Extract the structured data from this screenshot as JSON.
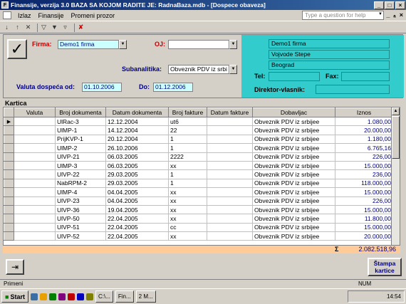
{
  "window": {
    "title": "Finansije, verzija 3.0      BAZA SA KOJOM RADITE JE: RadnaBaza.mdb - [Dospece obaveza]",
    "minimize": "_",
    "maximize": "□",
    "close": "×"
  },
  "menu": {
    "items": [
      "Izlaz",
      "Finansije",
      "Promeni prozor"
    ],
    "help_placeholder": "Type a question for help",
    "mdi_buttons": [
      "_",
      "ₐ",
      "×"
    ]
  },
  "toolbar": {
    "icons": [
      "sort-asc-icon",
      "sort-desc-icon",
      "filter-off-icon",
      "filter-icon",
      "filter-form-icon",
      "filter-apply-icon",
      "delete-filter-icon"
    ]
  },
  "form": {
    "firma_label": "Firma:",
    "firma_value": "Demo1 firma",
    "oj_label": "OJ:",
    "oj_value": "",
    "subanalitika_label": "Subanalitika:",
    "subanalitika_value": "Obveznik PDV iz srbi",
    "valuta_od_label": "Valuta dospeća od:",
    "valuta_od_value": "01.10.2006",
    "do_label": "Do:",
    "do_value": "01.12.2006"
  },
  "firm_panel": {
    "name": "Demo1 firma",
    "street": "Vojvode Stepe",
    "city": "Beograd",
    "tel_label": "Tel:",
    "tel_value": "",
    "fax_label": "Fax:",
    "fax_value": "",
    "director_label": "Direktor-vlasnik:",
    "director_value": ""
  },
  "kartica": {
    "label": "Kartica",
    "columns": [
      "Valuta",
      "Broj dokumenta",
      "Datum dokumenta",
      "Broj fakture",
      "Datum fakture",
      "Dobavljac",
      "Iznos"
    ],
    "rows": [
      {
        "valuta": "",
        "broj_dok": "UlRac-3",
        "datum_dok": "12.12.2004",
        "broj_fak": "ut6",
        "datum_fak": "",
        "dobavljac": "Obveznik PDV iz srbijee",
        "iznos": "1.080,00"
      },
      {
        "valuta": "",
        "broj_dok": "UlMP-1",
        "datum_dok": "14.12.2004",
        "broj_fak": "22",
        "datum_fak": "",
        "dobavljac": "Obveznik PDV iz srbijee",
        "iznos": "20.000,00"
      },
      {
        "valuta": "",
        "broj_dok": "PrijKVP-1",
        "datum_dok": "20.12.2004",
        "broj_fak": "1",
        "datum_fak": "",
        "dobavljac": "Obveznik PDV iz srbijee",
        "iznos": "1.180,00"
      },
      {
        "valuta": "",
        "broj_dok": "UlMP-2",
        "datum_dok": "26.10.2006",
        "broj_fak": "1",
        "datum_fak": "",
        "dobavljac": "Obveznik PDV iz srbijee",
        "iznos": "6.765,16"
      },
      {
        "valuta": "",
        "broj_dok": "UlVP-21",
        "datum_dok": "06.03.2005",
        "broj_fak": "2222",
        "datum_fak": "",
        "dobavljac": "Obveznik PDV iz srbijee",
        "iznos": "226,00"
      },
      {
        "valuta": "",
        "broj_dok": "UlMP-3",
        "datum_dok": "06.03.2005",
        "broj_fak": "xx",
        "datum_fak": "",
        "dobavljac": "Obveznik PDV iz srbijee",
        "iznos": "15.000,00"
      },
      {
        "valuta": "",
        "broj_dok": "UlVP-22",
        "datum_dok": "29.03.2005",
        "broj_fak": "1",
        "datum_fak": "",
        "dobavljac": "Obveznik PDV iz srbijee",
        "iznos": "236,00"
      },
      {
        "valuta": "",
        "broj_dok": "NabRPM-2",
        "datum_dok": "29.03.2005",
        "broj_fak": "1",
        "datum_fak": "",
        "dobavljac": "Obveznik PDV iz srbijee",
        "iznos": "118.000,00"
      },
      {
        "valuta": "",
        "broj_dok": "UlMP-4",
        "datum_dok": "04.04.2005",
        "broj_fak": "xx",
        "datum_fak": "",
        "dobavljac": "Obveznik PDV iz srbijee",
        "iznos": "15.000,00"
      },
      {
        "valuta": "",
        "broj_dok": "UlVP-23",
        "datum_dok": "04.04.2005",
        "broj_fak": "xx",
        "datum_fak": "",
        "dobavljac": "Obveznik PDV iz srbijee",
        "iznos": "226,00"
      },
      {
        "valuta": "",
        "broj_dok": "UlVP-36",
        "datum_dok": "19.04.2005",
        "broj_fak": "xx",
        "datum_fak": "",
        "dobavljac": "Obveznik PDV iz srbijee",
        "iznos": "15.000,00"
      },
      {
        "valuta": "",
        "broj_dok": "UlVP-50",
        "datum_dok": "22.04.2005",
        "broj_fak": "xx",
        "datum_fak": "",
        "dobavljac": "Obveznik PDV iz srbijee",
        "iznos": "11.800,00"
      },
      {
        "valuta": "",
        "broj_dok": "UlVP-51",
        "datum_dok": "22.04.2005",
        "broj_fak": "cc",
        "datum_fak": "",
        "dobavljac": "Obveznik PDV iz srbijee",
        "iznos": "15.000,00"
      },
      {
        "valuta": "",
        "broj_dok": "UlVP-52",
        "datum_dok": "22.04.2005",
        "broj_fak": "xx",
        "datum_fak": "",
        "dobavljac": "Obveznik PDV iz srbijee",
        "iznos": "20.000,00"
      }
    ],
    "sigma": "Σ",
    "total": "2.082.518,96"
  },
  "buttons": {
    "stampa_line1": "Štampa",
    "stampa_line2": "kartice"
  },
  "status": {
    "text": "Primeni",
    "num": "NUM"
  },
  "taskbar": {
    "start": "Start",
    "tasks": [
      "C:\\...",
      "Fin...",
      "2 M..."
    ],
    "clock": "14:54"
  }
}
